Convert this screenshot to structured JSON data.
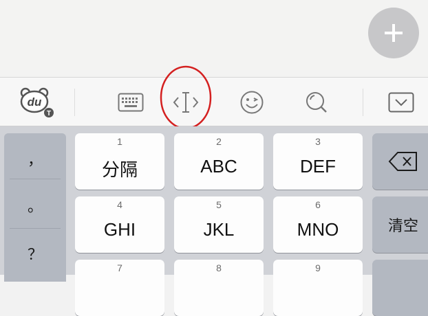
{
  "toolbar": {
    "items": [
      {
        "name": "du-logo-icon"
      },
      {
        "name": "keyboard-icon"
      },
      {
        "name": "cursor-move-icon"
      },
      {
        "name": "emoji-icon"
      },
      {
        "name": "search-icon"
      },
      {
        "name": "collapse-keyboard-icon"
      }
    ],
    "logo_text": "du",
    "logo_badge": "T"
  },
  "fab": {
    "icon": "plus-icon"
  },
  "annotation": {
    "color": "#d42020"
  },
  "keyboard": {
    "punctuation": [
      "，",
      "。",
      "？"
    ],
    "keys": [
      {
        "num": "1",
        "label": "分隔"
      },
      {
        "num": "2",
        "label": "ABC"
      },
      {
        "num": "3",
        "label": "DEF"
      },
      {
        "num": "4",
        "label": "GHI"
      },
      {
        "num": "5",
        "label": "JKL"
      },
      {
        "num": "6",
        "label": "MNO"
      },
      {
        "num": "7",
        "label": ""
      },
      {
        "num": "8",
        "label": ""
      },
      {
        "num": "9",
        "label": ""
      }
    ],
    "delete_icon": "backspace-icon",
    "clear_label": "清空"
  }
}
